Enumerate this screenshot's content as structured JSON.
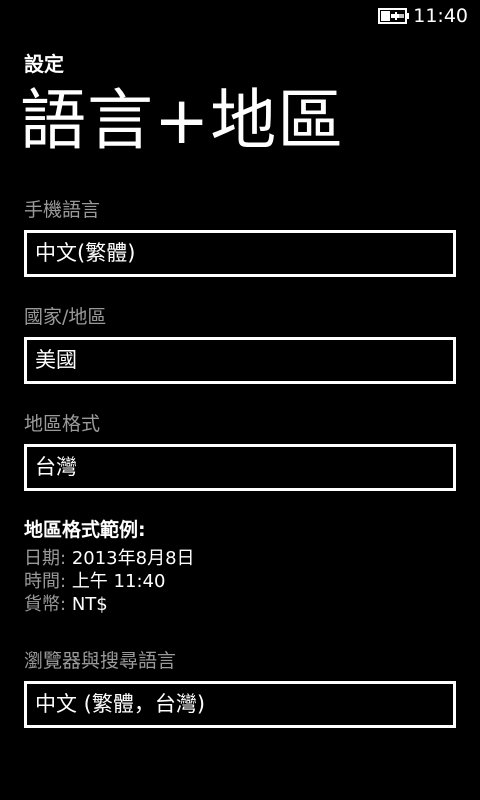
{
  "status_bar": {
    "battery_icon": "battery-charging-icon",
    "time": "11:40"
  },
  "header": {
    "app_title": "設定",
    "page_title": "語言+地區"
  },
  "fields": {
    "phone_language": {
      "label": "手機語言",
      "value": "中文(繁體)"
    },
    "country_region": {
      "label": "國家/地區",
      "value": "美國"
    },
    "regional_format": {
      "label": "地區格式",
      "value": "台灣"
    },
    "browser_search_language": {
      "label": "瀏覽器與搜尋語言",
      "value": "中文 (繁體，台灣)"
    }
  },
  "format_example": {
    "heading": "地區格式範例:",
    "date_label": "日期:",
    "date_value": "2013年8月8日",
    "time_label": "時間:",
    "time_value": "上午 11:40",
    "currency_label": "貨幣:",
    "currency_value": "NT$"
  },
  "colors": {
    "background": "#000000",
    "text": "#ffffff",
    "label_gray": "#9a9a9a",
    "field_border": "#ffffff"
  }
}
